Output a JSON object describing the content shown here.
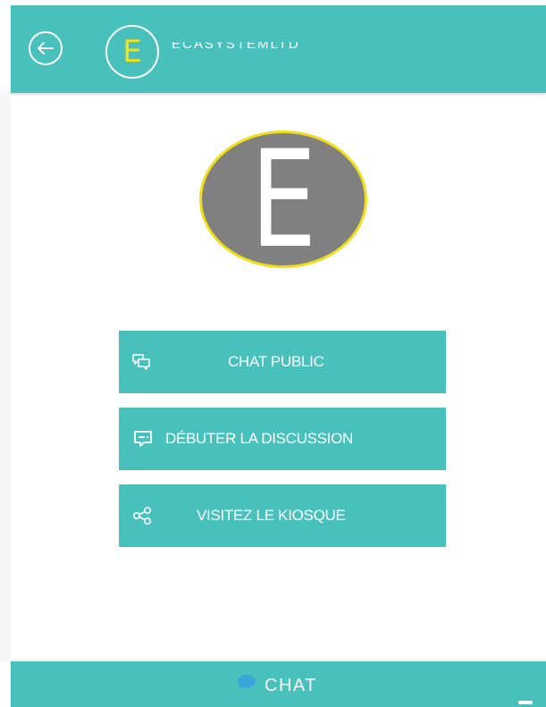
{
  "header": {
    "avatar_letter": "E",
    "name": "ECASYSTEMLTD"
  },
  "profile": {
    "avatar_letter": "E"
  },
  "actions": [
    {
      "label": "CHAT PUBLIC",
      "icon": "chat-bubbles-icon"
    },
    {
      "label": "DÉBUTER LA DISCUSSION",
      "icon": "message-icon"
    },
    {
      "label": "VISITEZ LE KIOSQUE",
      "icon": "share-icon"
    }
  ],
  "footer": {
    "label": "CHAT",
    "icon": "chat-bubble-icon",
    "minimize_icon": "minimize-icon"
  },
  "colors": {
    "accent": "#48c1bd",
    "avatar_ring": "#f0df18",
    "avatar_fill": "#808080"
  }
}
